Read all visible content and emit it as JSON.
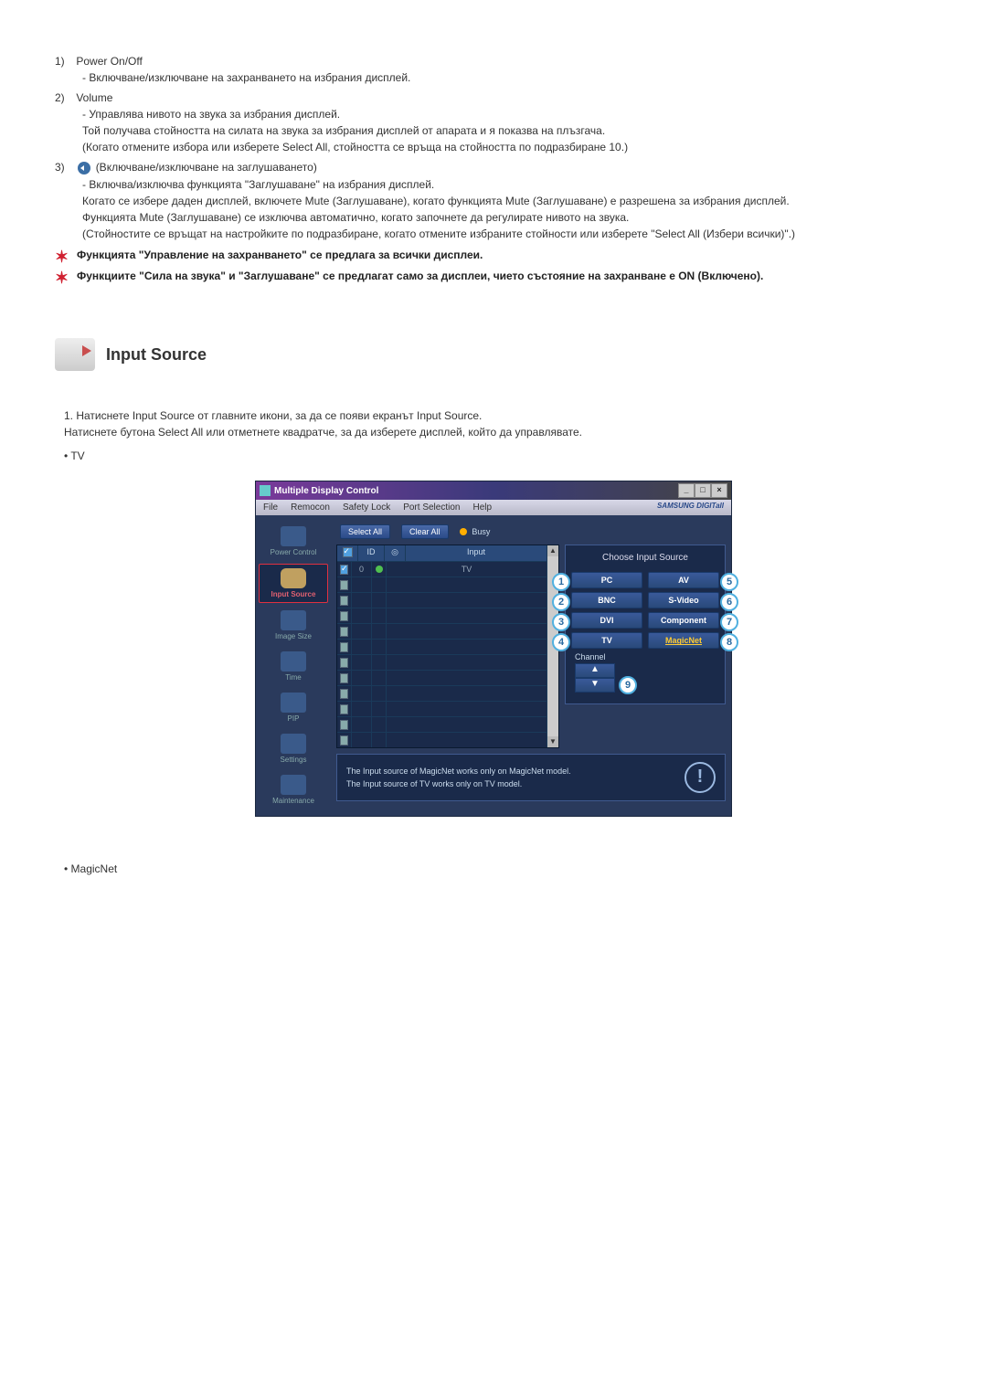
{
  "list": {
    "item1": {
      "num": "1)",
      "title": "Power On/Off",
      "desc": "- Включване/изключване на захранването на избрания дисплей."
    },
    "item2": {
      "num": "2)",
      "title": "Volume",
      "desc": "- Управлява нивото на звука за избрания дисплей.\nТой получава стойността на силата на звука за избрания дисплей от апарата и я показва на плъзгача.\n(Когато отмените избора или изберете Select All, стойността се връща на стойността по подразбиране 10.)"
    },
    "item3": {
      "num": "3)",
      "title": "(Включване/изключване на заглушаването)",
      "desc": "- Включва/изключва функцията \"Заглушаване\" на избрания дисплей.\nКогато се избере даден дисплей, включете Mute (Заглушаване), когато функцията Mute (Заглушаване) е разрешена за избрания дисплей.\nФункцията Mute (Заглушаване) се изключва автоматично, когато започнете да регулирате нивото на звука.\n(Стойностите се връщат на настройките по подразбиране, когато отмените избраните стойности или изберете \"Select All (Избери всички)\".)"
    }
  },
  "notes": {
    "n1": "Функцията \"Управление на захранването\" се предлага за всички дисплеи.",
    "n2": "Функциите \"Сила на звука\" и \"Заглушаване\" се предлагат само за дисплеи, чието състояние на захранване е ON (Включено)."
  },
  "section": {
    "title": "Input Source",
    "step1": "Натиснете Input Source от главните икони, за да се появи екранът Input Source.\nНатиснете бутона Select All или отметнете квадратче, за да изберете дисплей, който да управлявате.",
    "step_num": "1.",
    "bullet_tv": "TV",
    "bullet_magicnet": "MagicNet"
  },
  "app": {
    "title": "Multiple Display Control",
    "menu": {
      "file": "File",
      "remocon": "Remocon",
      "safety": "Safety Lock",
      "port": "Port Selection",
      "help": "Help"
    },
    "brand": "SAMSUNG DIGITall",
    "toolbar": {
      "select_all": "Select All",
      "clear_all": "Clear All",
      "busy": "Busy"
    },
    "sidebar": {
      "power": "Power Control",
      "input": "Input Source",
      "image": "Image Size",
      "time": "Time",
      "pip": "PIP",
      "settings": "Settings",
      "maint": "Maintenance"
    },
    "grid": {
      "head_id": "ID",
      "head_input": "Input",
      "row0_id": "0",
      "row0_input": "TV"
    },
    "panel": {
      "title": "Choose Input Source",
      "pc": "PC",
      "av": "AV",
      "bnc": "BNC",
      "svideo": "S-Video",
      "dvi": "DVI",
      "component": "Component",
      "tv": "TV",
      "magicnet": "MagicNet",
      "channel": "Channel",
      "b1": "1",
      "b2": "2",
      "b3": "3",
      "b4": "4",
      "b5": "5",
      "b6": "6",
      "b7": "7",
      "b8": "8",
      "b9": "9"
    },
    "footer": {
      "l1": "The Input source of MagicNet works only on MagicNet model.",
      "l2": "The Input source of TV works only on TV model."
    }
  }
}
